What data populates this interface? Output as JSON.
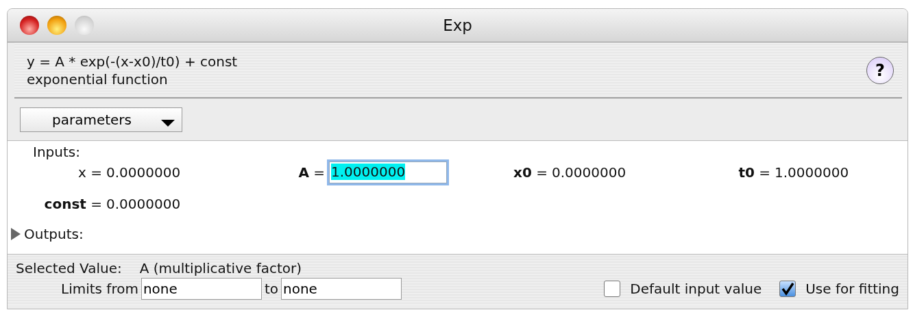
{
  "window": {
    "title": "Exp"
  },
  "formula": "y = A * exp(-(x-x0)/t0)  + const",
  "description": "exponential function",
  "help_button": {
    "label": "?"
  },
  "view_menu": {
    "value": "parameters"
  },
  "inputs": {
    "heading": "Inputs:",
    "params": [
      {
        "label": "x =",
        "kind": "text",
        "value": "0.0000000"
      },
      {
        "label": "**A** =",
        "kind": "field",
        "value": "1.0000000",
        "selected": true
      },
      {
        "label": "**x0** =",
        "kind": "text",
        "value": "0.0000000"
      },
      {
        "label": "**t0** =",
        "kind": "text",
        "value": "1.0000000"
      },
      {
        "label": "**const** =",
        "kind": "text",
        "value": "0.0000000"
      }
    ]
  },
  "outputs": {
    "label": "Outputs:",
    "expanded": false
  },
  "selected_value": {
    "label": "Selected Value:",
    "value": "A  (multiplicative factor)"
  },
  "limits": {
    "from_label": "Limits from",
    "from_value": "none",
    "to_label": "to",
    "to_value": "none"
  },
  "options": [
    {
      "label": "Default input value",
      "checked": false
    },
    {
      "label": "Use for fitting",
      "checked": true
    }
  ]
}
